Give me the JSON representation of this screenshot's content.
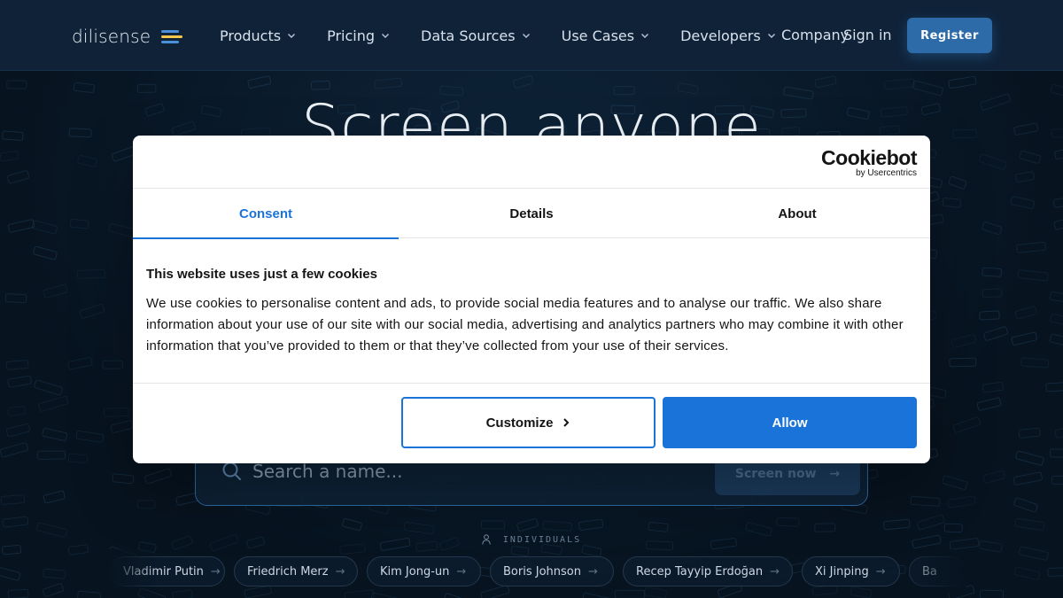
{
  "header": {
    "logo_text": "dilisense",
    "logo_colors": [
      "#4a90d9",
      "#f2c94c",
      "#4a90d9"
    ],
    "nav": [
      {
        "label": "Products"
      },
      {
        "label": "Pricing"
      },
      {
        "label": "Data Sources"
      },
      {
        "label": "Use Cases"
      },
      {
        "label": "Developers"
      }
    ],
    "company_label": "Company",
    "signin_label": "Sign in",
    "register_label": "Register"
  },
  "hero": {
    "title": "Screen anyone"
  },
  "search": {
    "placeholder": "Search a name...",
    "value": "",
    "button_label": "Screen now",
    "button_arrow": "→"
  },
  "suggestions": {
    "label": "INDIVIDUALS",
    "chips": [
      {
        "label": "Vladimir Putin"
      },
      {
        "label": "Friedrich Merz"
      },
      {
        "label": "Kim Jong-un"
      },
      {
        "label": "Boris Johnson"
      },
      {
        "label": "Recep Tayyip Erdoğan"
      },
      {
        "label": "Xi Jinping"
      },
      {
        "label": "Ba"
      }
    ],
    "arrow": "→"
  },
  "cookie_dialog": {
    "brand": "Cookiebot",
    "brand_sub": "by Usercentrics",
    "tabs": [
      {
        "label": "Consent",
        "active": true
      },
      {
        "label": "Details",
        "active": false
      },
      {
        "label": "About",
        "active": false
      }
    ],
    "title": "This website uses just a few cookies",
    "text": "We use cookies to personalise content and ads, to provide social media features and to analyse our traffic. We also share information about your use of our site with our social media, advertising and analytics partners who may combine it with other information that you’ve provided to them or that they’ve collected from your use of their services.",
    "customize_label": "Customize",
    "allow_label": "Allow",
    "accent_color": "#1a73d9"
  }
}
